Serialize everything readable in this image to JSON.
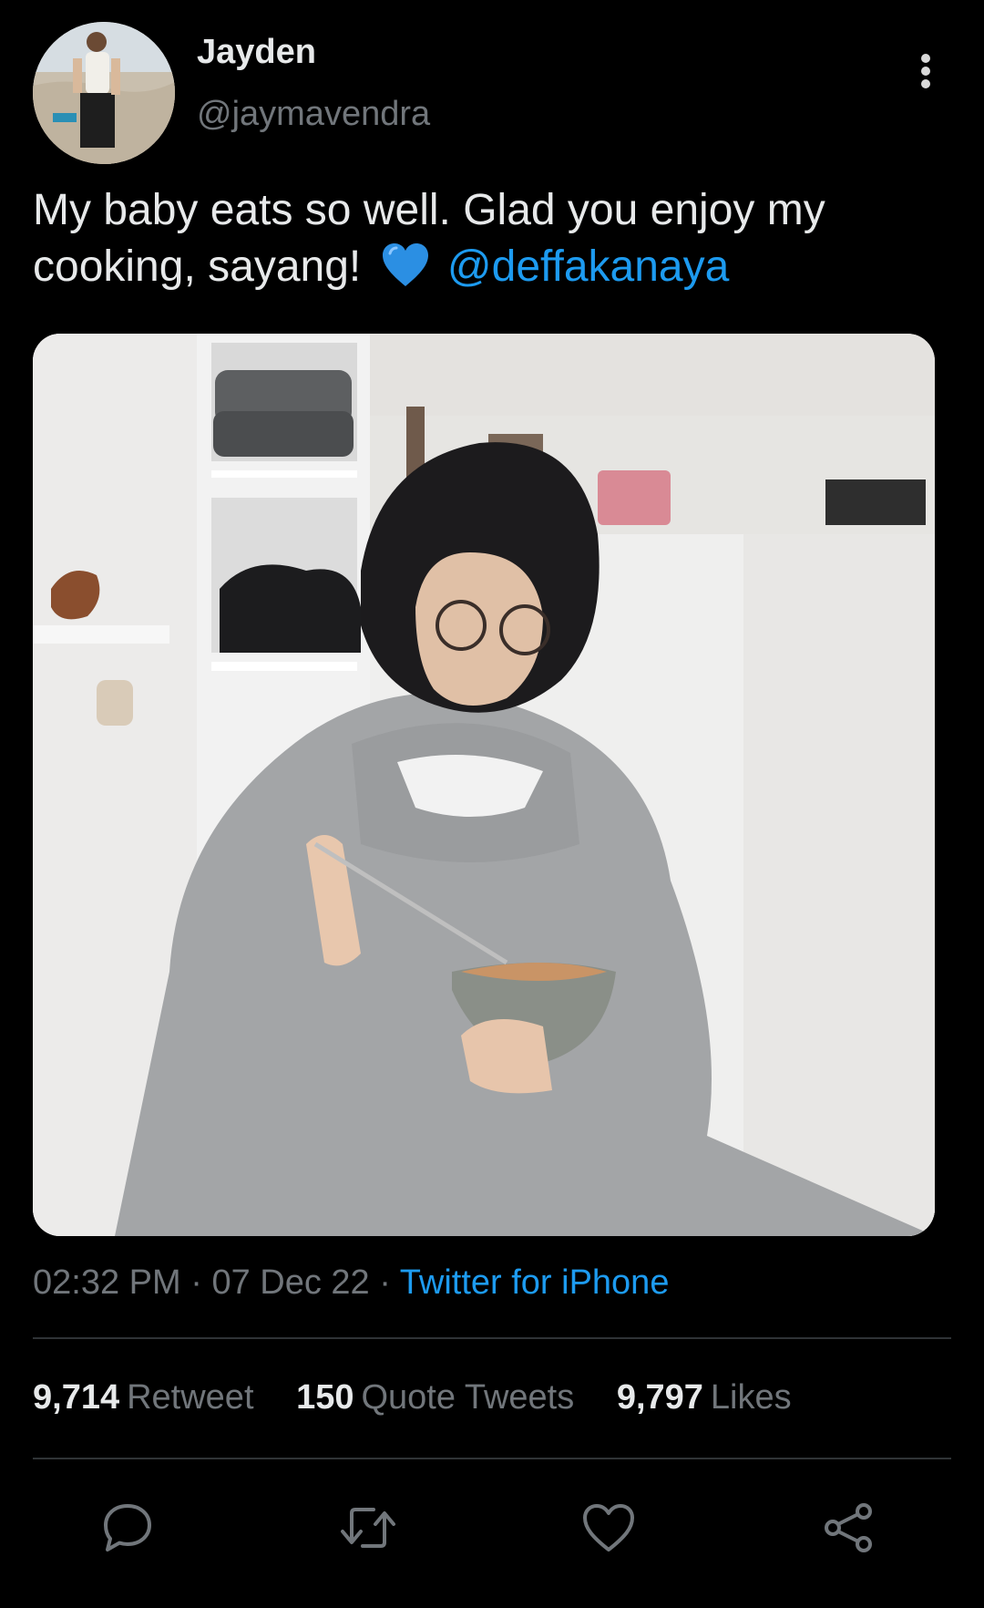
{
  "tweet": {
    "author": {
      "display_name": "Jayden",
      "handle": "@jaymavendra"
    },
    "text_part1": "My baby eats so well. Glad you enjoy my cooking, sayang!",
    "emoji": "blue-heart",
    "mention": "@deffakanaya",
    "time": "02:32 PM",
    "date": "07 Dec 22",
    "separator": "·",
    "source": "Twitter for iPhone"
  },
  "stats": {
    "retweets_count": "9,714",
    "retweets_label": "Retweet",
    "quotes_count": "150",
    "quotes_label": "Quote Tweets",
    "likes_count": "9,797",
    "likes_label": "Likes"
  },
  "icons": {
    "more": "more-vertical-icon",
    "reply": "reply-icon",
    "retweet": "retweet-icon",
    "like": "heart-icon",
    "share": "share-icon"
  },
  "colors": {
    "background": "#000000",
    "text": "#e7e9ea",
    "muted": "#71767b",
    "accent": "#1d9bf0",
    "divider": "#2f3336"
  }
}
